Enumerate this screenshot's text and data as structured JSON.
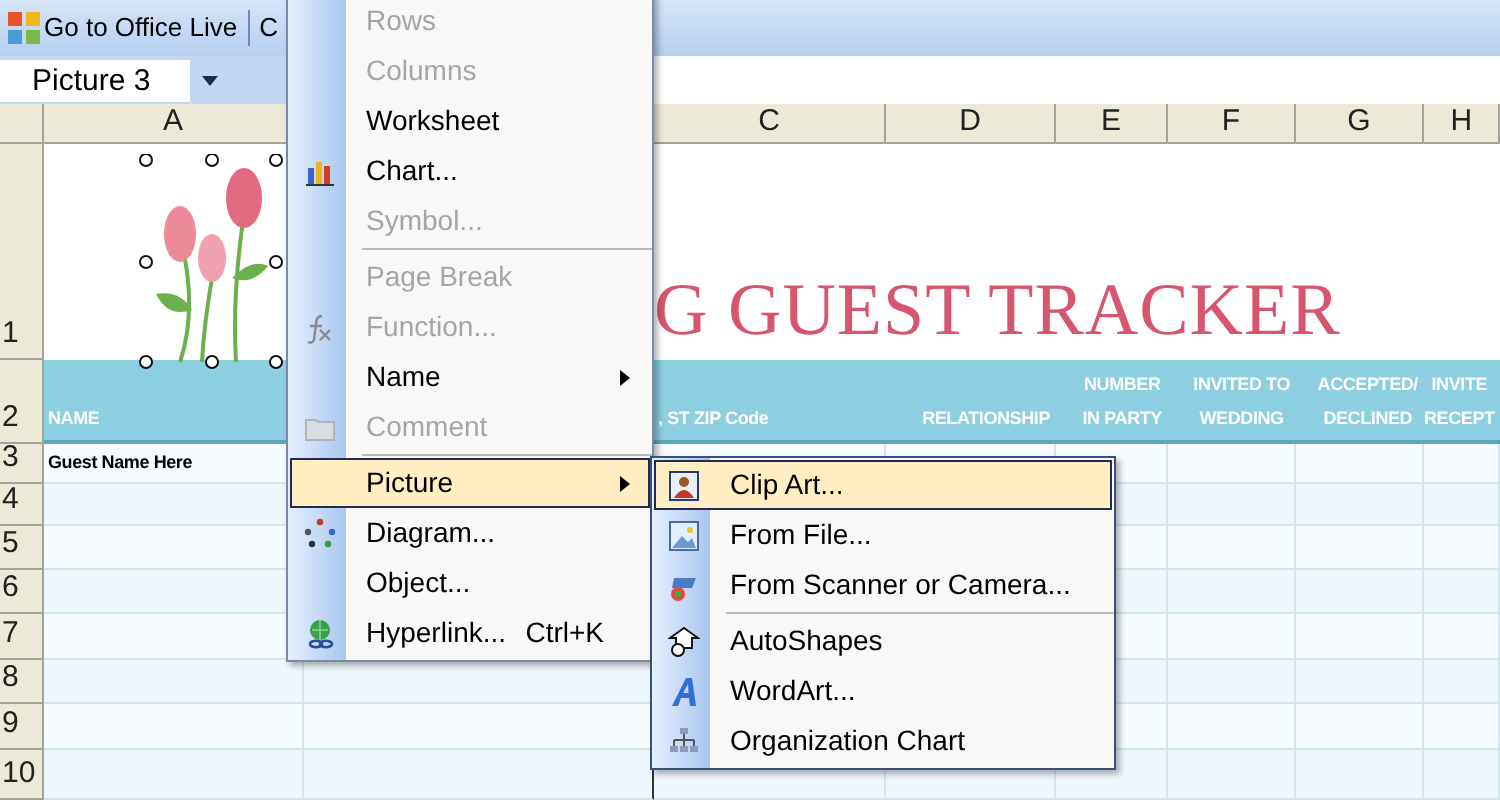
{
  "toolbar": {
    "buttons": [
      {
        "label": "Go to Office Live"
      },
      {
        "label": "C"
      }
    ]
  },
  "name_box": {
    "value": "Picture 3"
  },
  "columns": [
    {
      "label": "A"
    },
    {
      "label": "C"
    },
    {
      "label": "D"
    },
    {
      "label": "E"
    },
    {
      "label": "F"
    },
    {
      "label": "G"
    },
    {
      "label": "H"
    }
  ],
  "rows": [
    {
      "label": "1"
    },
    {
      "label": "2"
    },
    {
      "label": "3"
    },
    {
      "label": "4"
    },
    {
      "label": "5"
    },
    {
      "label": "6"
    },
    {
      "label": "7"
    },
    {
      "label": "8"
    },
    {
      "label": "9"
    },
    {
      "label": "10"
    }
  ],
  "title": "G GUEST TRACKER",
  "header_cells": [
    {
      "lines": [
        "NAME"
      ]
    },
    {
      "lines": [
        ", ST  ZIP Code"
      ]
    },
    {
      "lines": [
        "RELATIONSHIP"
      ]
    },
    {
      "lines": [
        "NUMBER",
        "IN PARTY"
      ]
    },
    {
      "lines": [
        "INVITED TO",
        "WEDDING"
      ]
    },
    {
      "lines": [
        "ACCEPTED/",
        "DECLINED"
      ]
    },
    {
      "lines": [
        "INVITE",
        "RECEPT"
      ]
    }
  ],
  "guest_cell": "Guest Name Here",
  "insert_menu": {
    "items": [
      {
        "kind": "item",
        "label": "Rows",
        "disabled": true,
        "selected": false,
        "has_submenu": false
      },
      {
        "kind": "item",
        "label": "Columns",
        "disabled": true,
        "selected": false,
        "has_submenu": false
      },
      {
        "kind": "item",
        "label": "Worksheet",
        "disabled": false,
        "selected": false,
        "has_submenu": false
      },
      {
        "kind": "item",
        "label": "Chart...",
        "disabled": false,
        "selected": false,
        "has_submenu": false
      },
      {
        "kind": "item",
        "label": "Symbol...",
        "disabled": true,
        "selected": false,
        "has_submenu": false
      },
      {
        "kind": "separator"
      },
      {
        "kind": "item",
        "label": "Page Break",
        "disabled": true,
        "selected": false,
        "has_submenu": false
      },
      {
        "kind": "item",
        "label": "Function...",
        "disabled": true,
        "selected": false,
        "has_submenu": false
      },
      {
        "kind": "item",
        "label": "Name",
        "disabled": false,
        "selected": false,
        "has_submenu": true
      },
      {
        "kind": "item",
        "label": "Comment",
        "disabled": true,
        "selected": false,
        "has_submenu": false
      },
      {
        "kind": "separator"
      },
      {
        "kind": "item",
        "label": "Picture",
        "disabled": false,
        "selected": true,
        "has_submenu": true
      },
      {
        "kind": "item",
        "label": "Diagram...",
        "disabled": false,
        "selected": false,
        "has_submenu": false
      },
      {
        "kind": "item",
        "label": "Object...",
        "disabled": false,
        "selected": false,
        "has_submenu": false
      },
      {
        "kind": "item",
        "label": "Hyperlink...",
        "disabled": false,
        "selected": false,
        "has_submenu": false,
        "shortcut": "Ctrl+K"
      }
    ]
  },
  "picture_submenu": {
    "items": [
      {
        "kind": "item",
        "label": "Clip Art...",
        "disabled": false,
        "selected": true,
        "has_submenu": false
      },
      {
        "kind": "item",
        "label": "From File...",
        "disabled": false,
        "selected": false,
        "has_submenu": false
      },
      {
        "kind": "item",
        "label": "From Scanner or Camera...",
        "disabled": false,
        "selected": false,
        "has_submenu": false
      },
      {
        "kind": "separator"
      },
      {
        "kind": "item",
        "label": "AutoShapes",
        "disabled": false,
        "selected": false,
        "has_submenu": false
      },
      {
        "kind": "item",
        "label": "WordArt...",
        "disabled": false,
        "selected": false,
        "has_submenu": false
      },
      {
        "kind": "item",
        "label": "Organization Chart",
        "disabled": false,
        "selected": false,
        "has_submenu": false
      }
    ]
  }
}
